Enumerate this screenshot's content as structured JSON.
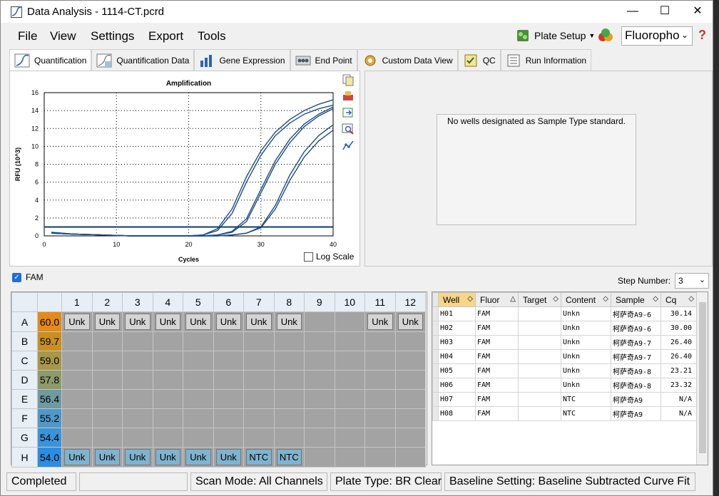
{
  "window": {
    "title": "Data Analysis - 1114-CT.pcrd"
  },
  "menu": [
    "File",
    "View",
    "Settings",
    "Export",
    "Tools"
  ],
  "toolbar": {
    "plate_setup": "Plate Setup",
    "fluorophore": "Fluoropho"
  },
  "tabs": [
    "Quantification",
    "Quantification Data",
    "Gene Expression",
    "End Point",
    "Custom Data View",
    "QC",
    "Run Information"
  ],
  "chart_data": {
    "type": "line",
    "title": "Amplification",
    "xlabel": "Cycles",
    "ylabel": "RFU (10^3)",
    "xlim": [
      0,
      40
    ],
    "ylim": [
      0,
      16
    ],
    "xticks": [
      0,
      10,
      20,
      30,
      40
    ],
    "yticks": [
      0,
      2,
      4,
      6,
      8,
      10,
      12,
      14,
      16
    ],
    "threshold": 1.0,
    "grid": true,
    "x": [
      1,
      4,
      8,
      12,
      16,
      20,
      22,
      24,
      26,
      28,
      30,
      32,
      34,
      36,
      38,
      40
    ],
    "series": [
      {
        "values": [
          0.4,
          0.2,
          0.1,
          0.0,
          0.0,
          0.0,
          0.1,
          0.6,
          2.5,
          6.0,
          9.0,
          11.2,
          12.6,
          13.6,
          14.2,
          14.6
        ]
      },
      {
        "values": [
          0.4,
          0.2,
          0.1,
          0.0,
          0.0,
          0.0,
          0.1,
          0.8,
          3.0,
          6.6,
          9.5,
          11.6,
          13.0,
          14.0,
          14.7,
          15.2
        ]
      },
      {
        "values": [
          0.3,
          0.2,
          0.1,
          0.0,
          0.0,
          0.0,
          0.0,
          0.1,
          0.4,
          1.6,
          4.8,
          8.0,
          10.4,
          12.2,
          13.4,
          14.2
        ]
      },
      {
        "values": [
          0.3,
          0.2,
          0.1,
          0.0,
          0.0,
          0.0,
          0.0,
          0.1,
          0.5,
          1.9,
          5.2,
          8.4,
          10.8,
          12.5,
          13.6,
          14.4
        ]
      },
      {
        "values": [
          0.3,
          0.2,
          0.1,
          0.0,
          0.0,
          0.0,
          0.0,
          0.0,
          0.1,
          0.3,
          0.9,
          3.0,
          6.2,
          8.8,
          10.6,
          11.8
        ]
      },
      {
        "values": [
          0.3,
          0.2,
          0.1,
          0.0,
          0.0,
          0.0,
          0.0,
          0.0,
          0.1,
          0.3,
          1.0,
          3.4,
          6.8,
          9.4,
          11.2,
          12.4
        ]
      }
    ]
  },
  "chart": {
    "log_scale_label": "Log Scale"
  },
  "std_message": "No wells designated as Sample Type standard.",
  "fam_label": "FAM",
  "step": {
    "label": "Step Number:",
    "value": "3"
  },
  "plate": {
    "columns": [
      "1",
      "2",
      "3",
      "4",
      "5",
      "6",
      "7",
      "8",
      "9",
      "10",
      "11",
      "12"
    ],
    "rows": [
      {
        "label": "A",
        "temp": "60.0",
        "color": "#e48a16",
        "wells": [
          "Unk",
          "Unk",
          "Unk",
          "Unk",
          "Unk",
          "Unk",
          "Unk",
          "Unk",
          "",
          "",
          "Unk",
          "Unk"
        ]
      },
      {
        "label": "B",
        "temp": "59.7",
        "color": "#c9901f",
        "wells": [
          "",
          "",
          "",
          "",
          "",
          "",
          "",
          "",
          "",
          "",
          "",
          ""
        ]
      },
      {
        "label": "C",
        "temp": "59.0",
        "color": "#a8974a",
        "wells": [
          "",
          "",
          "",
          "",
          "",
          "",
          "",
          "",
          "",
          "",
          "",
          ""
        ]
      },
      {
        "label": "D",
        "temp": "57.8",
        "color": "#8d9a6a",
        "wells": [
          "",
          "",
          "",
          "",
          "",
          "",
          "",
          "",
          "",
          "",
          "",
          ""
        ]
      },
      {
        "label": "E",
        "temp": "56.4",
        "color": "#6f9aa0",
        "wells": [
          "",
          "",
          "",
          "",
          "",
          "",
          "",
          "",
          "",
          "",
          "",
          ""
        ]
      },
      {
        "label": "F",
        "temp": "55.2",
        "color": "#4f98c8",
        "wells": [
          "",
          "",
          "",
          "",
          "",
          "",
          "",
          "",
          "",
          "",
          "",
          ""
        ]
      },
      {
        "label": "G",
        "temp": "54.4",
        "color": "#3b93d9",
        "wells": [
          "",
          "",
          "",
          "",
          "",
          "",
          "",
          "",
          "",
          "",
          "",
          ""
        ]
      },
      {
        "label": "H",
        "temp": "54.0",
        "color": "#2b8ee0",
        "wells": [
          "Unk",
          "Unk",
          "Unk",
          "Unk",
          "Unk",
          "Unk",
          "NTC",
          "NTC",
          "",
          "",
          "",
          ""
        ]
      }
    ]
  },
  "well_table": {
    "headers": [
      "Well",
      "Fluor",
      "Target",
      "Content",
      "Sample",
      "Cq"
    ],
    "rows": [
      [
        "H01",
        "FAM",
        "",
        "Unkn",
        "柯萨奇A9-6",
        "30.14"
      ],
      [
        "H02",
        "FAM",
        "",
        "Unkn",
        "柯萨奇A9-6",
        "30.00"
      ],
      [
        "H03",
        "FAM",
        "",
        "Unkn",
        "柯萨奇A9-7",
        "26.40"
      ],
      [
        "H04",
        "FAM",
        "",
        "Unkn",
        "柯萨奇A9-7",
        "26.40"
      ],
      [
        "H05",
        "FAM",
        "",
        "Unkn",
        "柯萨奇A9-8",
        "23.21"
      ],
      [
        "H06",
        "FAM",
        "",
        "Unkn",
        "柯萨奇A9-8",
        "23.32"
      ],
      [
        "H07",
        "FAM",
        "",
        "NTC",
        "柯萨奇A9",
        "N/A"
      ],
      [
        "H08",
        "FAM",
        "",
        "NTC",
        "柯萨奇A9",
        "N/A"
      ]
    ]
  },
  "status": [
    "Completed",
    "",
    "Scan Mode: All Channels",
    "Plate Type: BR Clear",
    "Baseline Setting: Baseline Subtracted Curve Fit"
  ]
}
